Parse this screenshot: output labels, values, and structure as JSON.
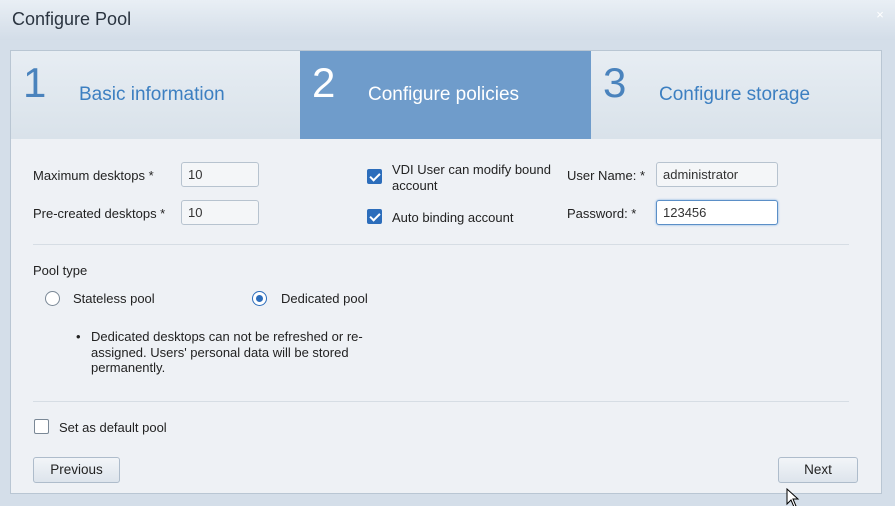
{
  "dialog": {
    "title": "Configure Pool",
    "close_glyph": "×"
  },
  "steps": [
    {
      "num": "1",
      "label": "Basic information",
      "active": false
    },
    {
      "num": "2",
      "label": "Configure policies",
      "active": true
    },
    {
      "num": "3",
      "label": "Configure storage",
      "active": false
    }
  ],
  "form": {
    "max_desktops_label": "Maximum desktops *",
    "max_desktops_value": "10",
    "precreated_label": "Pre-created desktops *",
    "precreated_value": "10",
    "vdi_modify_label": "VDI User can modify bound account",
    "vdi_modify_checked": true,
    "auto_binding_label": "Auto binding account",
    "auto_binding_checked": true,
    "username_label": "User Name: *",
    "username_value": "administrator",
    "password_label": "Password: *",
    "password_value": "123456"
  },
  "pool_type": {
    "heading": "Pool type",
    "options": [
      {
        "label": "Stateless pool",
        "selected": false
      },
      {
        "label": "Dedicated pool",
        "selected": true
      }
    ],
    "note": "Dedicated desktops can not be refreshed or re-assigned. Users' personal data will be stored permanently."
  },
  "default_pool": {
    "label": "Set as default pool",
    "checked": false
  },
  "buttons": {
    "previous": "Previous",
    "next": "Next"
  },
  "colors": {
    "active_step": "#6f9ccb",
    "step_text": "#3c7fc1",
    "checkbox_accent": "#2c6dbb"
  },
  "icons": {
    "close": "close-icon",
    "cursor": "mouse-pointer-icon"
  }
}
